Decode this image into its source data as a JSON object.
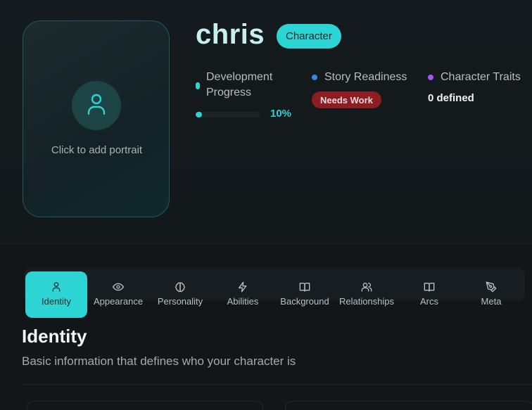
{
  "colors": {
    "accent": "#2dd4d4",
    "background": "#121619",
    "needs_work": "#8d1d20",
    "story_dot": "#3b82f6",
    "traits_dot": "#a855f7"
  },
  "portrait": {
    "icon": "user-icon",
    "label": "Click to add portrait"
  },
  "character": {
    "name": "chris",
    "type_badge": "Character"
  },
  "stats": {
    "development": {
      "label": "Development Progress",
      "progress": 0.1,
      "percent_text": "10%"
    },
    "story": {
      "label": "Story Readiness",
      "status": "Needs Work"
    },
    "traits": {
      "label": "Character Traits",
      "count_text": "0 defined"
    }
  },
  "tabs": [
    {
      "label": "Identity",
      "icon": "user-icon",
      "active": true
    },
    {
      "label": "Appearance",
      "icon": "eye-icon",
      "active": false
    },
    {
      "label": "Personality",
      "icon": "brain-icon",
      "active": false
    },
    {
      "label": "Abilities",
      "icon": "lightning-icon",
      "active": false
    },
    {
      "label": "Background",
      "icon": "book-open-icon",
      "active": false
    },
    {
      "label": "Relationships",
      "icon": "users-icon",
      "active": false
    },
    {
      "label": "Arcs",
      "icon": "book-open-icon",
      "active": false
    },
    {
      "label": "Meta",
      "icon": "pen-tool-icon",
      "active": false
    }
  ],
  "section": {
    "title": "Identity",
    "description": "Basic information that defines who your character is"
  }
}
